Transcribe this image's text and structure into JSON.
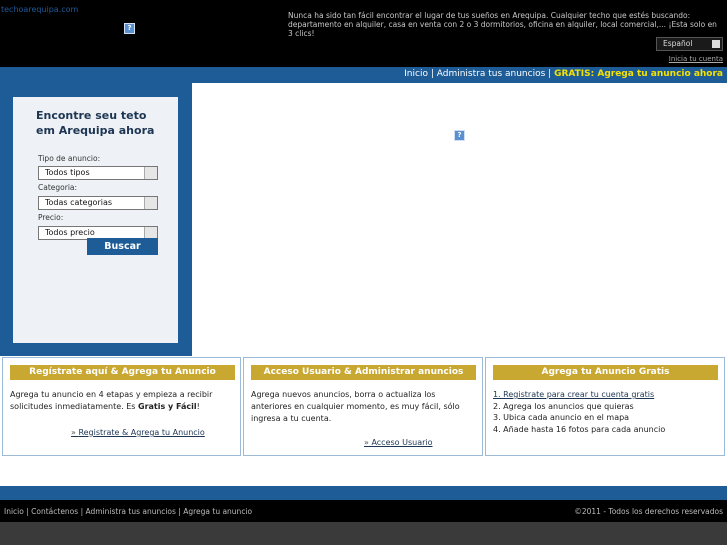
{
  "header": {
    "logo_text": "techoarequipa.com",
    "tagline": "Nunca ha sido tan fácil encontrar el lugar de tus sueños en Arequipa. Cualquier techo que estés buscando: departamento en alquiler, casa en venta con 2 o 3 dormitorios, oficina en alquiler, local comercial,... ¡Esta solo en 3 clics!",
    "language": "Español",
    "login_link": "Inicia tu cuenta"
  },
  "nav": {
    "inicio": "Inicio",
    "sep1": " | ",
    "admin": "Administra tus anuncios",
    "sep2": " | ",
    "gratis": "GRATIS: Agrega tu anuncio ahora"
  },
  "search": {
    "title": "Encontre seu teto em Arequipa ahora",
    "tipo_label": "Tipo de anuncio:",
    "tipo_value": "Todos tipos",
    "categoria_label": "Categoria:",
    "categoria_value": "Todas categorias",
    "precio_label": "Precio:",
    "precio_value": "Todos precio",
    "button": "Buscar"
  },
  "columns": {
    "register": {
      "heading": "Regístrate aquí & Agrega tu Anuncio",
      "body_a": "Agrega tu anuncio en 4 etapas y empieza a recibir solicitudes inmediatamente. Es ",
      "body_b": "Gratis y Fácil",
      "body_c": "!",
      "link": "Registrate & Agrega tu Anuncio"
    },
    "access": {
      "heading": "Acceso Usuario & Administrar anuncios",
      "body": "Agrega nuevos anuncios, borra o actualiza los anteriores en cualquier momento, es muy fácil, sólo ingresa a tu cuenta.",
      "link": "Acceso Usuario"
    },
    "free": {
      "heading": "Agrega tu Anuncio Gratis",
      "items": [
        "1. Registrate para crear tu cuenta gratis",
        "2. Agrega los anuncios que quieras",
        "3. Ubica cada anuncio en el mapa",
        "4. Añade hasta 16 fotos para cada anuncio"
      ]
    }
  },
  "footer": {
    "links": "Inicio | Contáctenos | Administra tus anuncios | Agrega tu anuncio",
    "copyright": "©2011 - Todos los derechos reservados"
  },
  "colors": {
    "brand_blue": "#1d5c96",
    "heading_gold": "#c9a832",
    "highlight_yellow": "#f4e200"
  }
}
